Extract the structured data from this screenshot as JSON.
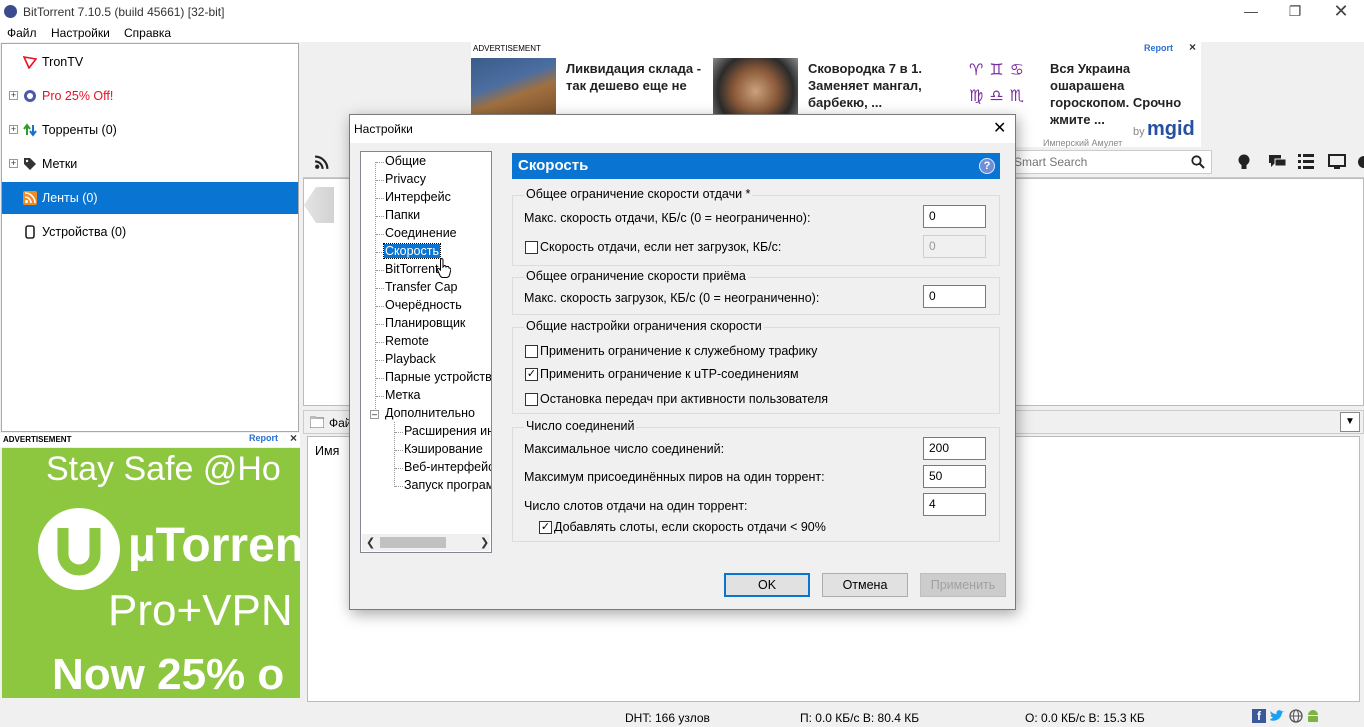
{
  "app": {
    "title": "BitTorrent 7.10.5  (build 45661) [32-bit]",
    "menu": [
      "Файл",
      "Настройки",
      "Справка"
    ]
  },
  "sidebar": {
    "items": [
      {
        "label": "TronTV"
      },
      {
        "label": "Pro 25% Off!"
      },
      {
        "label": "Торренты (0)"
      },
      {
        "label": "Метки"
      },
      {
        "label": "Ленты (0)"
      },
      {
        "label": "Устройства (0)"
      }
    ]
  },
  "ads": {
    "label": "ADVERTISEMENT",
    "report": "Report",
    "close": "×",
    "top_cards": [
      {
        "text": "Ликвидация склада - так дешево еще не"
      },
      {
        "text": "Сковородка 7 в 1. Заменяет мангал, барбекю, ..."
      },
      {
        "text": "Вся Украина ошарашена гороскопом. Срочно жмите ..."
      }
    ],
    "mgid_by": "by",
    "mgid": "mgid",
    "mgid_sub": "Имперский Амулет",
    "left_lines": [
      "Stay Safe @Ho",
      "µTorren",
      "Pro+VPN",
      "Now 25% o"
    ]
  },
  "main": {
    "search_placeholder": "Smart Search",
    "lower_tab": "Фай",
    "column_name": "Имя"
  },
  "status": {
    "dht": "DHT: 166 узлов",
    "down": "П: 0.0 КБ/с В: 80.4 КБ",
    "up": "О: 0.0 КБ/с В: 15.3 КБ"
  },
  "dialog": {
    "title": "Настройки",
    "tree": [
      "Общие",
      "Privacy",
      "Интерфейс",
      "Папки",
      "Соединение",
      "Скорость",
      "BitTorrent",
      "Transfer Cap",
      "Очерёдность",
      "Планировщик",
      "Remote",
      "Playback",
      "Парные устройства",
      "Метка",
      "Дополнительно",
      "Расширения ин",
      "Кэширование",
      "Веб-интерфейс",
      "Запуск програм"
    ],
    "panel_title": "Скорость",
    "help": "?",
    "upload_group": {
      "title": "Общее ограничение скорости отдачи *",
      "max_label": "Макс. скорость отдачи, КБ/с (0 = неограниченно):",
      "max_value": "0",
      "nodl_label": "Скорость отдачи, если нет загрузок, КБ/с:",
      "nodl_checked": false,
      "nodl_value": "0"
    },
    "download_group": {
      "title": "Общее ограничение скорости приёма",
      "max_label": "Макс. скорость загрузок, КБ/с (0 = неограниченно):",
      "max_value": "0"
    },
    "general_group": {
      "title": "Общие настройки ограничения скорости",
      "options": [
        {
          "label": "Применить ограничение к служебному трафику",
          "checked": false
        },
        {
          "label": "Применить ограничение к uTP-соединениям",
          "checked": true
        },
        {
          "label": "Остановка передач при активности пользователя",
          "checked": false
        }
      ]
    },
    "conn_group": {
      "title": "Число соединений",
      "max_conn_label": "Максимальное число соединений:",
      "max_conn_value": "200",
      "peers_label": "Максимум присоединённых пиров на один торрент:",
      "peers_value": "50",
      "slots_label": "Число слотов отдачи на один торрент:",
      "slots_value": "4",
      "extra_label": "Добавлять слоты, если скорость отдачи < 90%",
      "extra_checked": true
    },
    "buttons": {
      "ok": "OK",
      "cancel": "Отмена",
      "apply": "Применить"
    }
  },
  "colors": {
    "accent": "#0a74d2",
    "ad_green": "#8dc63f",
    "promo_red": "#e81123"
  }
}
